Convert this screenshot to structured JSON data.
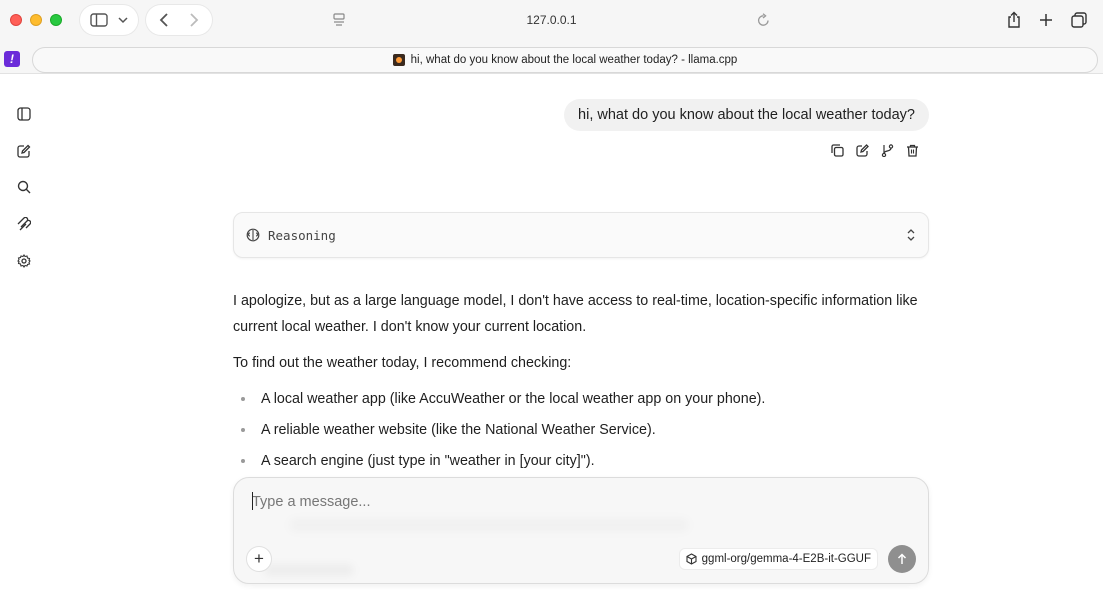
{
  "browser": {
    "url": "127.0.0.1",
    "tab_title": "hi, what do you know about the local weather today? - llama.cpp",
    "extension_label": "!"
  },
  "icons": {
    "sidebar": [
      "sidebar-toggle-icon",
      "new-chat-icon",
      "search-icon",
      "mcp-icon",
      "settings-icon"
    ],
    "message_actions": [
      "copy-icon",
      "edit-icon",
      "branch-icon",
      "delete-icon"
    ]
  },
  "chat": {
    "user_message": "hi, what do you know about the local weather today?",
    "reasoning_label": "Reasoning",
    "assistant": {
      "para1": "I apologize, but as a large language model, I don't have access to real-time, location-specific information like current local weather. I don't know your current location.",
      "para2": "To find out the weather today, I recommend checking:",
      "items": [
        "A local weather app (like AccuWeather or the local weather app on your phone).",
        "A reliable weather website (like the National Weather Service).",
        "A search engine (just type in \"weather in [your city]\")."
      ]
    }
  },
  "composer": {
    "placeholder": "Type a message...",
    "value": "",
    "model": "ggml-org/gemma-4-E2B-it-GGUF",
    "add_label": "+"
  },
  "colors": {
    "accent_send": "#8f8f8f",
    "extension_purple": "#6b2bd9"
  }
}
